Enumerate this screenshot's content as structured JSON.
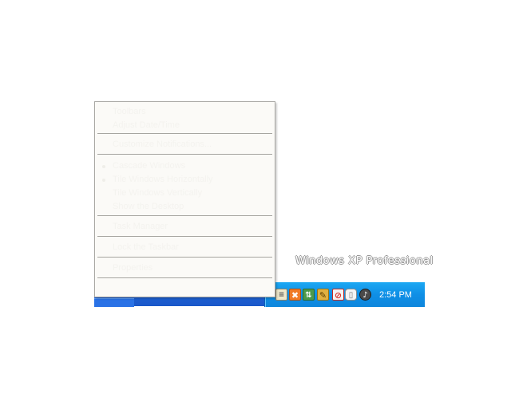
{
  "desktop": {
    "watermark": "Windows XP Professional"
  },
  "tray": {
    "clock": "2:54 PM",
    "icons": [
      {
        "name": "notepad-icon",
        "color": "#e8e2c4"
      },
      {
        "name": "xampp-icon",
        "color": "#f07a26"
      },
      {
        "name": "network-icon",
        "color": "#3a8a3a"
      },
      {
        "name": "pencil-icon",
        "color": "#d9a531"
      },
      {
        "name": "antivirus-icon",
        "color": "#d8342c"
      },
      {
        "name": "cylinder-icon",
        "color": "#e6e6e6"
      },
      {
        "name": "volume-icon",
        "color": "#3d3d3d"
      }
    ]
  },
  "context_menu": {
    "items": [
      {
        "label": "Toolbars"
      },
      {
        "label": "Adjust Date/Time"
      },
      {
        "label": "Customize Notifications..."
      },
      {
        "label": "Cascade Windows"
      },
      {
        "label": "Tile Windows Horizontally"
      },
      {
        "label": "Tile Windows Vertically"
      },
      {
        "label": "Show the Desktop"
      },
      {
        "label": "Task Manager"
      },
      {
        "label": "Lock the Taskbar"
      },
      {
        "label": "Properties"
      }
    ]
  },
  "colors": {
    "taskbar": "#1f63d6",
    "tray": "#0f8fe6",
    "menu_bg": "#fbfaf7",
    "menu_separator": "#a6a5a0"
  }
}
